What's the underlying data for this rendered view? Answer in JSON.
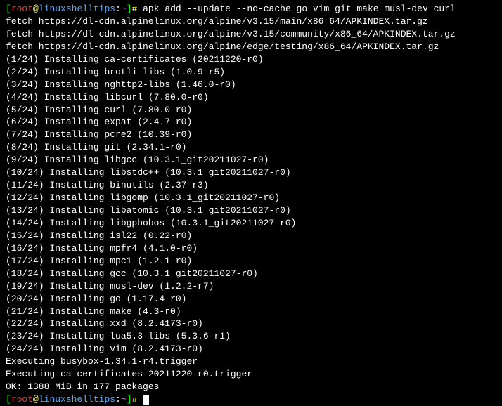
{
  "prompt": {
    "lbracket": "[",
    "user": "root",
    "at": "@",
    "host": "linuxshelltips",
    "colon": ":",
    "path": "~",
    "rbracket": "]",
    "hash": "# "
  },
  "command": "apk add --update --no-cache go vim git make musl-dev curl",
  "fetch": [
    "fetch https://dl-cdn.alpinelinux.org/alpine/v3.15/main/x86_64/APKINDEX.tar.gz",
    "fetch https://dl-cdn.alpinelinux.org/alpine/v3.15/community/x86_64/APKINDEX.tar.gz",
    "fetch https://dl-cdn.alpinelinux.org/alpine/edge/testing/x86_64/APKINDEX.tar.gz"
  ],
  "install": [
    "(1/24) Installing ca-certificates (20211220-r0)",
    "(2/24) Installing brotli-libs (1.0.9-r5)",
    "(3/24) Installing nghttp2-libs (1.46.0-r0)",
    "(4/24) Installing libcurl (7.80.0-r0)",
    "(5/24) Installing curl (7.80.0-r0)",
    "(6/24) Installing expat (2.4.7-r0)",
    "(7/24) Installing pcre2 (10.39-r0)",
    "(8/24) Installing git (2.34.1-r0)",
    "(9/24) Installing libgcc (10.3.1_git20211027-r0)",
    "(10/24) Installing libstdc++ (10.3.1_git20211027-r0)",
    "(11/24) Installing binutils (2.37-r3)",
    "(12/24) Installing libgomp (10.3.1_git20211027-r0)",
    "(13/24) Installing libatomic (10.3.1_git20211027-r0)",
    "(14/24) Installing libgphobos (10.3.1_git20211027-r0)",
    "(15/24) Installing isl22 (0.22-r0)",
    "(16/24) Installing mpfr4 (4.1.0-r0)",
    "(17/24) Installing mpc1 (1.2.1-r0)",
    "(18/24) Installing gcc (10.3.1_git20211027-r0)",
    "(19/24) Installing musl-dev (1.2.2-r7)",
    "(20/24) Installing go (1.17.4-r0)",
    "(21/24) Installing make (4.3-r0)",
    "(22/24) Installing xxd (8.2.4173-r0)",
    "(23/24) Installing lua5.3-libs (5.3.6-r1)",
    "(24/24) Installing vim (8.2.4173-r0)"
  ],
  "trailer": [
    "Executing busybox-1.34.1-r4.trigger",
    "Executing ca-certificates-20211220-r0.trigger",
    "OK: 1388 MiB in 177 packages"
  ]
}
